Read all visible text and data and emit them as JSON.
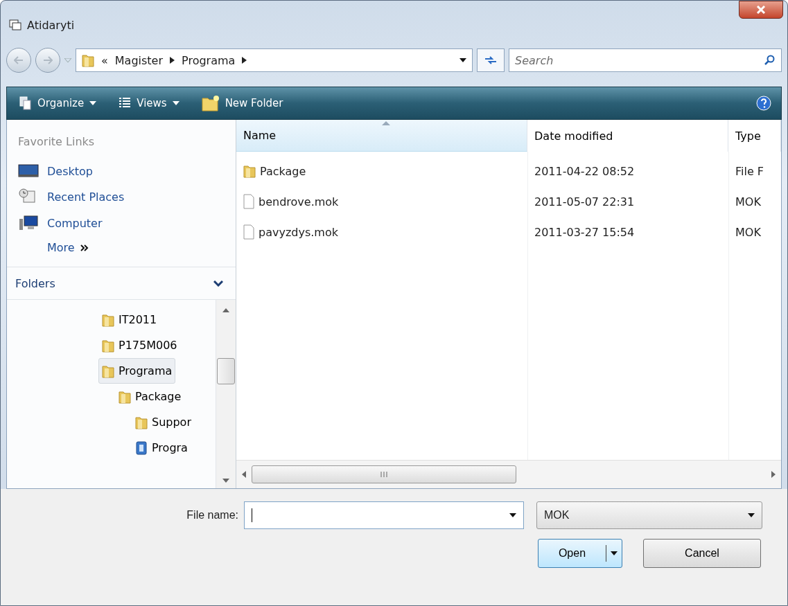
{
  "window": {
    "title": "Atidaryti"
  },
  "address": {
    "overflow": "«",
    "crumbs": [
      "Magister",
      "Programa"
    ]
  },
  "search": {
    "placeholder": "Search"
  },
  "toolbar": {
    "items": [
      {
        "label": "Organize",
        "kind": "menu"
      },
      {
        "label": "Views",
        "kind": "menu"
      },
      {
        "label": "New Folder",
        "kind": "action"
      }
    ]
  },
  "favorite_links": {
    "title": "Favorite Links",
    "items": [
      {
        "label": "Desktop",
        "kind": "desktop"
      },
      {
        "label": "Recent Places",
        "kind": "recent"
      },
      {
        "label": "Computer",
        "kind": "computer"
      }
    ],
    "more": "More"
  },
  "folders": {
    "title": "Folders",
    "expanded": true,
    "tree": [
      {
        "label": "IT2011",
        "kind": "folder",
        "selected": false
      },
      {
        "label": "P175M006",
        "kind": "folder",
        "selected": false
      },
      {
        "label": "Programa",
        "kind": "folder",
        "selected": true,
        "children": [
          {
            "label": "Package",
            "kind": "folder",
            "selected": false,
            "children": [
              {
                "label": "Suppor",
                "kind": "folder",
                "selected": false
              },
              {
                "label": "Progra",
                "kind": "app",
                "selected": false
              }
            ]
          }
        ]
      }
    ]
  },
  "table": {
    "columns": [
      {
        "label": "Name",
        "sorted": true
      },
      {
        "label": "Date modified",
        "sorted": false
      },
      {
        "label": "Type",
        "sorted": false
      }
    ],
    "rows": [
      {
        "kind": "folder",
        "cells": [
          "Package",
          "2011-04-22 08:52",
          "File F"
        ]
      },
      {
        "kind": "file",
        "cells": [
          "bendrove.mok",
          "2011-05-07 22:31",
          "MOK"
        ]
      },
      {
        "kind": "file",
        "cells": [
          "pavyzdys.mok",
          "2011-03-27 15:54",
          "MOK"
        ]
      }
    ]
  },
  "file_name": {
    "label": "File name:"
  },
  "file_type": {
    "value": "MOK"
  },
  "buttons": [
    {
      "label": "Open",
      "kind": "split"
    },
    {
      "label": "Cancel",
      "kind": "plain"
    }
  ]
}
